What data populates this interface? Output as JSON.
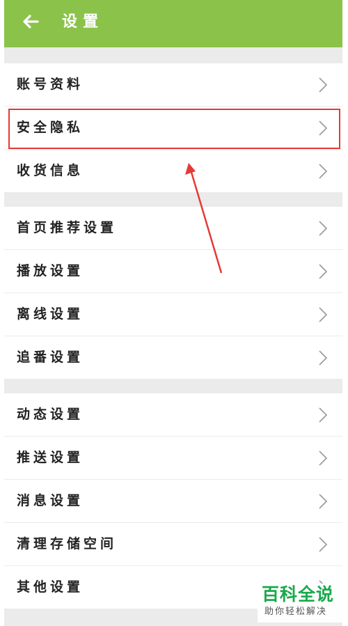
{
  "header": {
    "title": "设置",
    "back_icon": "back-arrow-icon",
    "color": "#8bc34a"
  },
  "groups": [
    {
      "items": [
        {
          "label": "账号资料"
        },
        {
          "label": "安全隐私"
        },
        {
          "label": "收货信息"
        }
      ]
    },
    {
      "items": [
        {
          "label": "首页推荐设置"
        },
        {
          "label": "播放设置"
        },
        {
          "label": "离线设置"
        },
        {
          "label": "追番设置"
        }
      ]
    },
    {
      "items": [
        {
          "label": "动态设置"
        },
        {
          "label": "推送设置"
        },
        {
          "label": "消息设置"
        },
        {
          "label": "清理存储空间"
        },
        {
          "label": "其他设置"
        }
      ]
    }
  ],
  "annotation": {
    "highlighted_item": "安全隐私",
    "color": "#e53935"
  },
  "watermark": {
    "title": "百科全说",
    "subtitle": "助你轻松解决"
  }
}
